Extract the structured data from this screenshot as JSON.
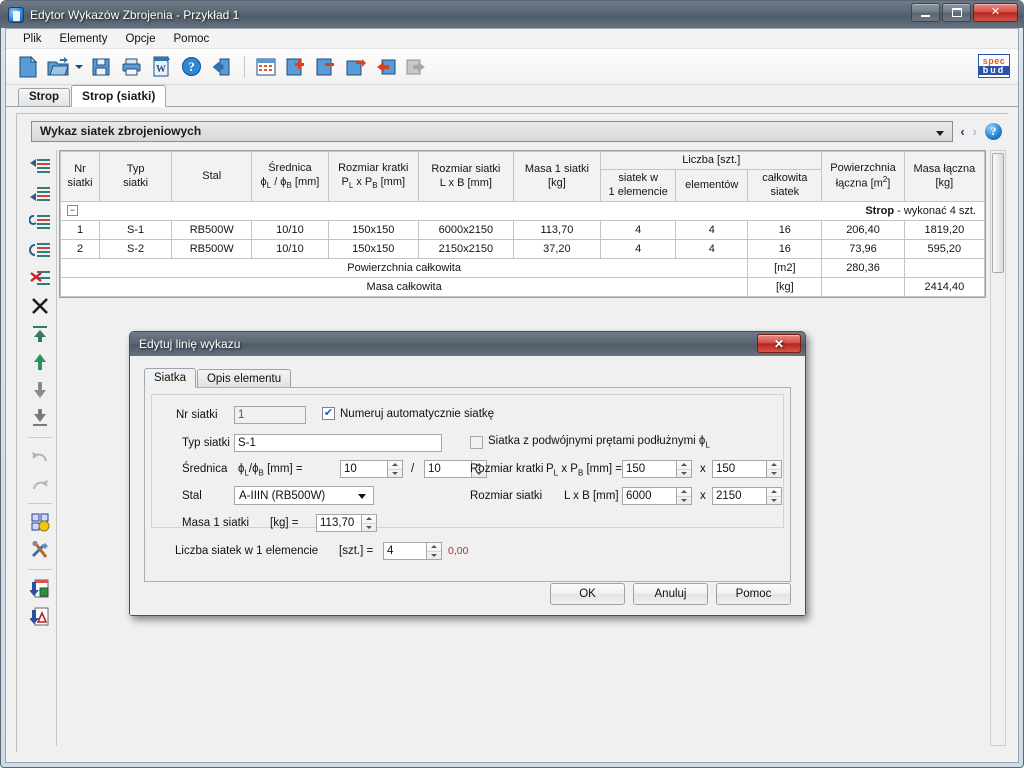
{
  "window": {
    "title": "Edytor Wykazów Zbrojenia - Przykład 1",
    "minimize": "—",
    "maximize": "□",
    "close": "✕"
  },
  "menu": {
    "items": [
      "Plik",
      "Elementy",
      "Opcje",
      "Pomoc"
    ]
  },
  "toolbar": {
    "groups": [
      [
        "new-document-icon",
        "open-folder-icon",
        "dropdown-caret-icon",
        "save-disk-icon",
        "print-icon",
        "export-word-icon",
        "help-icon",
        "exit-icon"
      ],
      [
        "table-grid-icon",
        "add-row-icon",
        "remove-row-icon",
        "edit-row-icon",
        "move-left-icon",
        "move-right-icon"
      ]
    ]
  },
  "tabs": [
    {
      "label": "Strop",
      "active": false
    },
    {
      "label": "Strop (siatki)",
      "active": true
    }
  ],
  "list_header": {
    "combo_value": "Wykaz siatek zbrojeniowych",
    "prev_arrow": "‹",
    "next_arrow": "›",
    "help_label": "?"
  },
  "logo": {
    "top": "spec",
    "bottom": "bud"
  },
  "side_tools": [
    "insert-row-above-icon",
    "insert-row-below-icon",
    "refresh-row-icon",
    "insert-row-left-icon",
    "cut-row-icon",
    "delete-row-icon",
    "move-to-top-icon",
    "move-up-icon",
    "move-down-icon",
    "move-to-bottom-icon",
    "undo-icon",
    "redo-icon",
    "settings-gear-icon",
    "tools-icon",
    "export-excel-icon",
    "export-pdf-icon"
  ],
  "table": {
    "header": {
      "col_nr": "Nr\nsiatki",
      "col_typ": "Typ\nsiatki",
      "col_stal": "Stal",
      "col_srednica_1": "Średnica",
      "col_srednica_2": "ϕL / ϕB [mm]",
      "col_kratka_1": "Rozmiar kratki",
      "col_kratka_2": "PL x PB [mm]",
      "col_siatka_1": "Rozmiar siatki",
      "col_siatka_2": "L x B [mm]",
      "col_masa1_1": "Masa 1 siatki",
      "col_masa1_2": "[kg]",
      "col_liczba": "Liczba [szt.]",
      "col_liczba_a": "siatek w\n1 elemencie",
      "col_liczba_b": "elementów",
      "col_liczba_c": "całkowita\nsiatek",
      "col_pow_1": "Powierzchnia",
      "col_pow_2": "łączna",
      "col_pow_3": "[m 2]",
      "col_masa_1": "Masa łączna",
      "col_masa_2": "[kg]"
    },
    "group_row": {
      "name": "Strop",
      "suffix": " - wykonać 4 szt."
    },
    "rows": [
      {
        "nr": "1",
        "typ": "S-1",
        "stal": "RB500W",
        "srednica": "10/10",
        "kratka": "150x150",
        "siatka": "6000x2150",
        "masa1": "113,70",
        "l_elem": "4",
        "l_elementow": "4",
        "l_calk": "16",
        "powierzchnia": "206,40",
        "masa": "1819,20",
        "selected": false
      },
      {
        "nr": "2",
        "typ": "S-2",
        "stal": "RB500W",
        "srednica": "10/10",
        "kratka": "150x150",
        "siatka": "2150x2150",
        "masa1": "37,20",
        "l_elem": "4",
        "l_elementow": "4",
        "l_calk": "16",
        "powierzchnia": "73,96",
        "masa": "595,20",
        "selected": true
      }
    ],
    "totals": [
      {
        "label": "Powierzchnia całkowita",
        "unit": "[m 2]",
        "pow_value": "280,36",
        "masa_value": ""
      },
      {
        "label": "Masa całkowita",
        "unit": "[kg]",
        "pow_value": "",
        "masa_value": "2414,40"
      }
    ]
  },
  "dialog": {
    "title": "Edytuj linię wykazu",
    "close": "✕",
    "tabs": [
      {
        "label": "Siatka",
        "active": true
      },
      {
        "label": "Opis elementu",
        "active": false
      }
    ],
    "fields": {
      "nr_siatki_label": "Nr siatki",
      "nr_siatki_value": "1",
      "auto_number_label": "Numeruj automatycznie siatkę",
      "auto_number_checked": true,
      "typ_siatki_label": "Typ siatki",
      "typ_siatki_value": "S-1",
      "double_bars_label": "Siatka z podwójnymi prętami podłużnymi ϕL",
      "double_bars_checked": false,
      "srednica_label": "Średnica",
      "srednica_unit": "ϕL/ϕB [mm] =",
      "srednica_value_1": "10",
      "srednica_sep": "/",
      "srednica_value_2": "10",
      "kratka_label": "Rozmiar kratki",
      "kratka_unit": "PL x PB [mm] =",
      "kratka_value_1": "150",
      "kratka_sep": "x",
      "kratka_value_2": "150",
      "stal_label": "Stal",
      "stal_value": "A-IIIN (RB500W)",
      "siatka_label": "Rozmiar siatki",
      "siatka_unit": "L x B [mm] =",
      "siatka_value_1": "6000",
      "siatka_sep": "x",
      "siatka_value_2": "2150",
      "masa_label": "Masa 1 siatki",
      "masa_unit": "[kg] =",
      "masa_value": "113,70",
      "liczba_label": "Liczba siatek w 1 elemencie",
      "liczba_unit": "[szt.] =",
      "liczba_value": "4",
      "liczba_hint": "0,00"
    },
    "buttons": {
      "ok": "OK",
      "cancel": "Anuluj",
      "help": "Pomoc"
    }
  }
}
